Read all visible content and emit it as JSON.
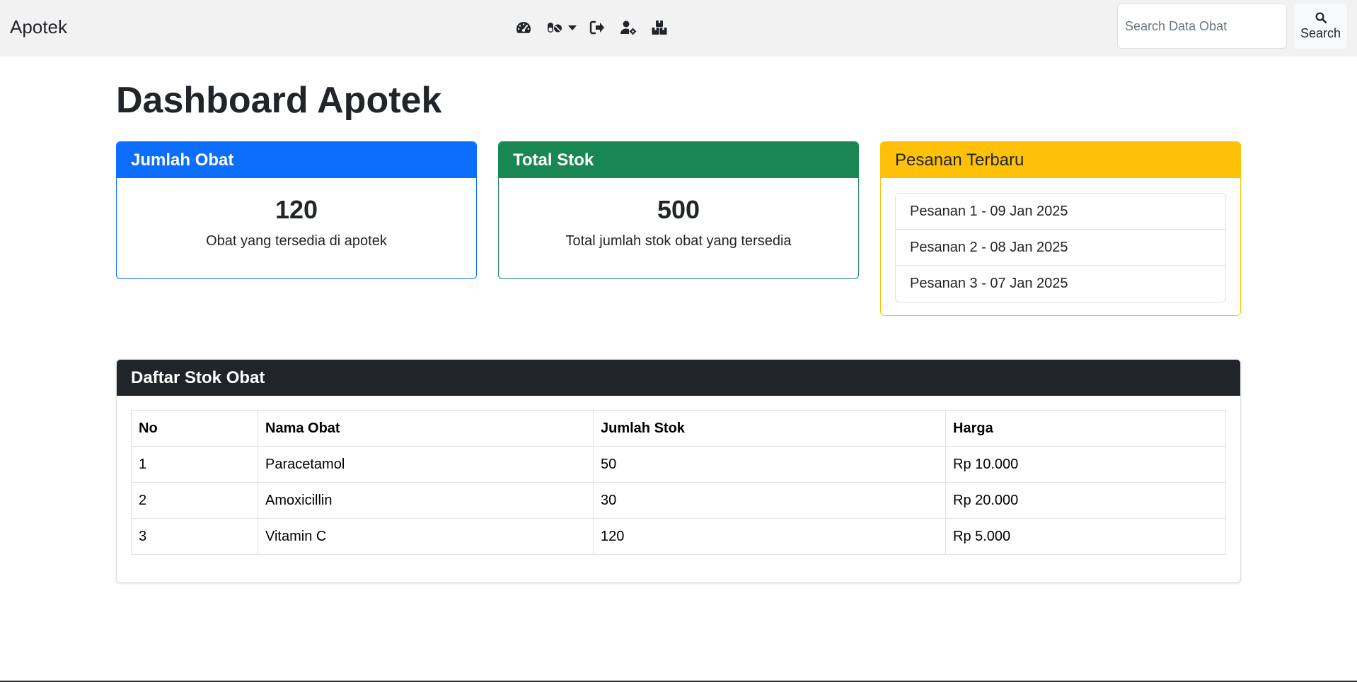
{
  "navbar": {
    "brand": "Apotek",
    "icons": [
      "dashboard-icon",
      "pills-icon",
      "sign-out-icon",
      "user-gear-icon",
      "boxes-icon"
    ],
    "search_placeholder": "Search Data Obat",
    "search_value": "",
    "search_button_label": "Search"
  },
  "page": {
    "title": "Dashboard Apotek"
  },
  "cards": {
    "jumlah_obat": {
      "header": "Jumlah Obat",
      "value": "120",
      "text": "Obat yang tersedia di apotek",
      "color": "#0d6efd"
    },
    "total_stok": {
      "header": "Total Stok",
      "value": "500",
      "text": "Total jumlah stok obat yang tersedia",
      "color": "#198754"
    },
    "pesanan": {
      "header": "Pesanan Terbaru",
      "color": "#ffc107",
      "items": [
        "Pesanan 1 - 09 Jan 2025",
        "Pesanan 2 - 08 Jan 2025",
        "Pesanan 3 - 07 Jan 2025"
      ]
    }
  },
  "stock_table": {
    "header": "Daftar Stok Obat",
    "header_color": "#212529",
    "columns": [
      "No",
      "Nama Obat",
      "Jumlah Stok",
      "Harga"
    ],
    "rows": [
      [
        "1",
        "Paracetamol",
        "50",
        "Rp 10.000"
      ],
      [
        "2",
        "Amoxicillin",
        "30",
        "Rp 20.000"
      ],
      [
        "3",
        "Vitamin C",
        "120",
        "Rp 5.000"
      ]
    ]
  }
}
